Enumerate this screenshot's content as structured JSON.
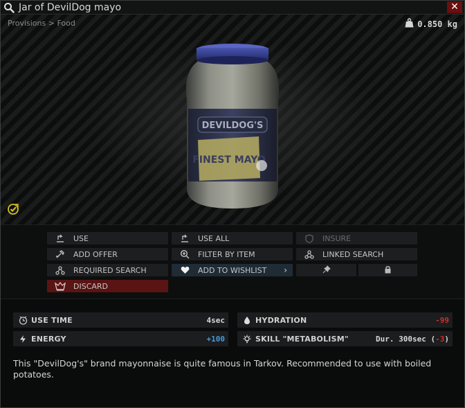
{
  "window": {
    "title": "Jar of DevilDog mayo",
    "close_label": "✕"
  },
  "preview": {
    "breadcrumb": [
      "Provisions",
      "Food"
    ],
    "breadcrumb_sep": ">",
    "weight": "0.850 kg",
    "product_label_brand": "DEVILDOG'S",
    "product_label_text": "FINEST MAYO"
  },
  "actions": {
    "use": "USE",
    "use_all": "USE ALL",
    "insure": "INSURE",
    "add_offer": "ADD OFFER",
    "filter_by_item": "FILTER BY ITEM",
    "linked_search": "LINKED SEARCH",
    "required_search": "REQUIRED SEARCH",
    "add_to_wishlist": "ADD TO WISHLIST",
    "discard": "DISCARD"
  },
  "stats": {
    "use_time": {
      "label": "USE TIME",
      "value": "4sec"
    },
    "hydration": {
      "label": "HYDRATION",
      "value": "-99"
    },
    "energy": {
      "label": "ENERGY",
      "value": "+100"
    },
    "skill": {
      "label": "SKILL \"METABOLISM\"",
      "value_prefix": "Dur. 300sec (",
      "value_accent": "-3",
      "value_suffix": ")"
    }
  },
  "description": "This \"DevilDog's\" brand mayonnaise is quite famous in Tarkov. Recommended to use with boiled potatoes.",
  "colors": {
    "discard_bg": "#5a1414",
    "wishlist_bg": "#1f2c36",
    "negative": "#c8322c",
    "positive": "#4a9ad8",
    "badge_yellow": "#d9c31a",
    "close_bg": "#6a0f0f"
  },
  "icons": {
    "title": "search-icon",
    "weight": "weight-icon",
    "badge": "checkmark-badge-icon",
    "use": "use-icon",
    "use_all": "use-all-icon",
    "insure": "shield-icon",
    "add_offer": "hammer-icon",
    "filter": "magnifier-plus-icon",
    "linked": "linked-nodes-icon",
    "required": "required-nodes-icon",
    "wishlist": "heart-icon",
    "pin": "pin-icon",
    "lock": "lock-icon",
    "discard": "trash-icon",
    "use_time": "clock-icon",
    "hydration": "drop-icon",
    "energy": "lightning-icon",
    "skill": "lightbulb-icon"
  }
}
